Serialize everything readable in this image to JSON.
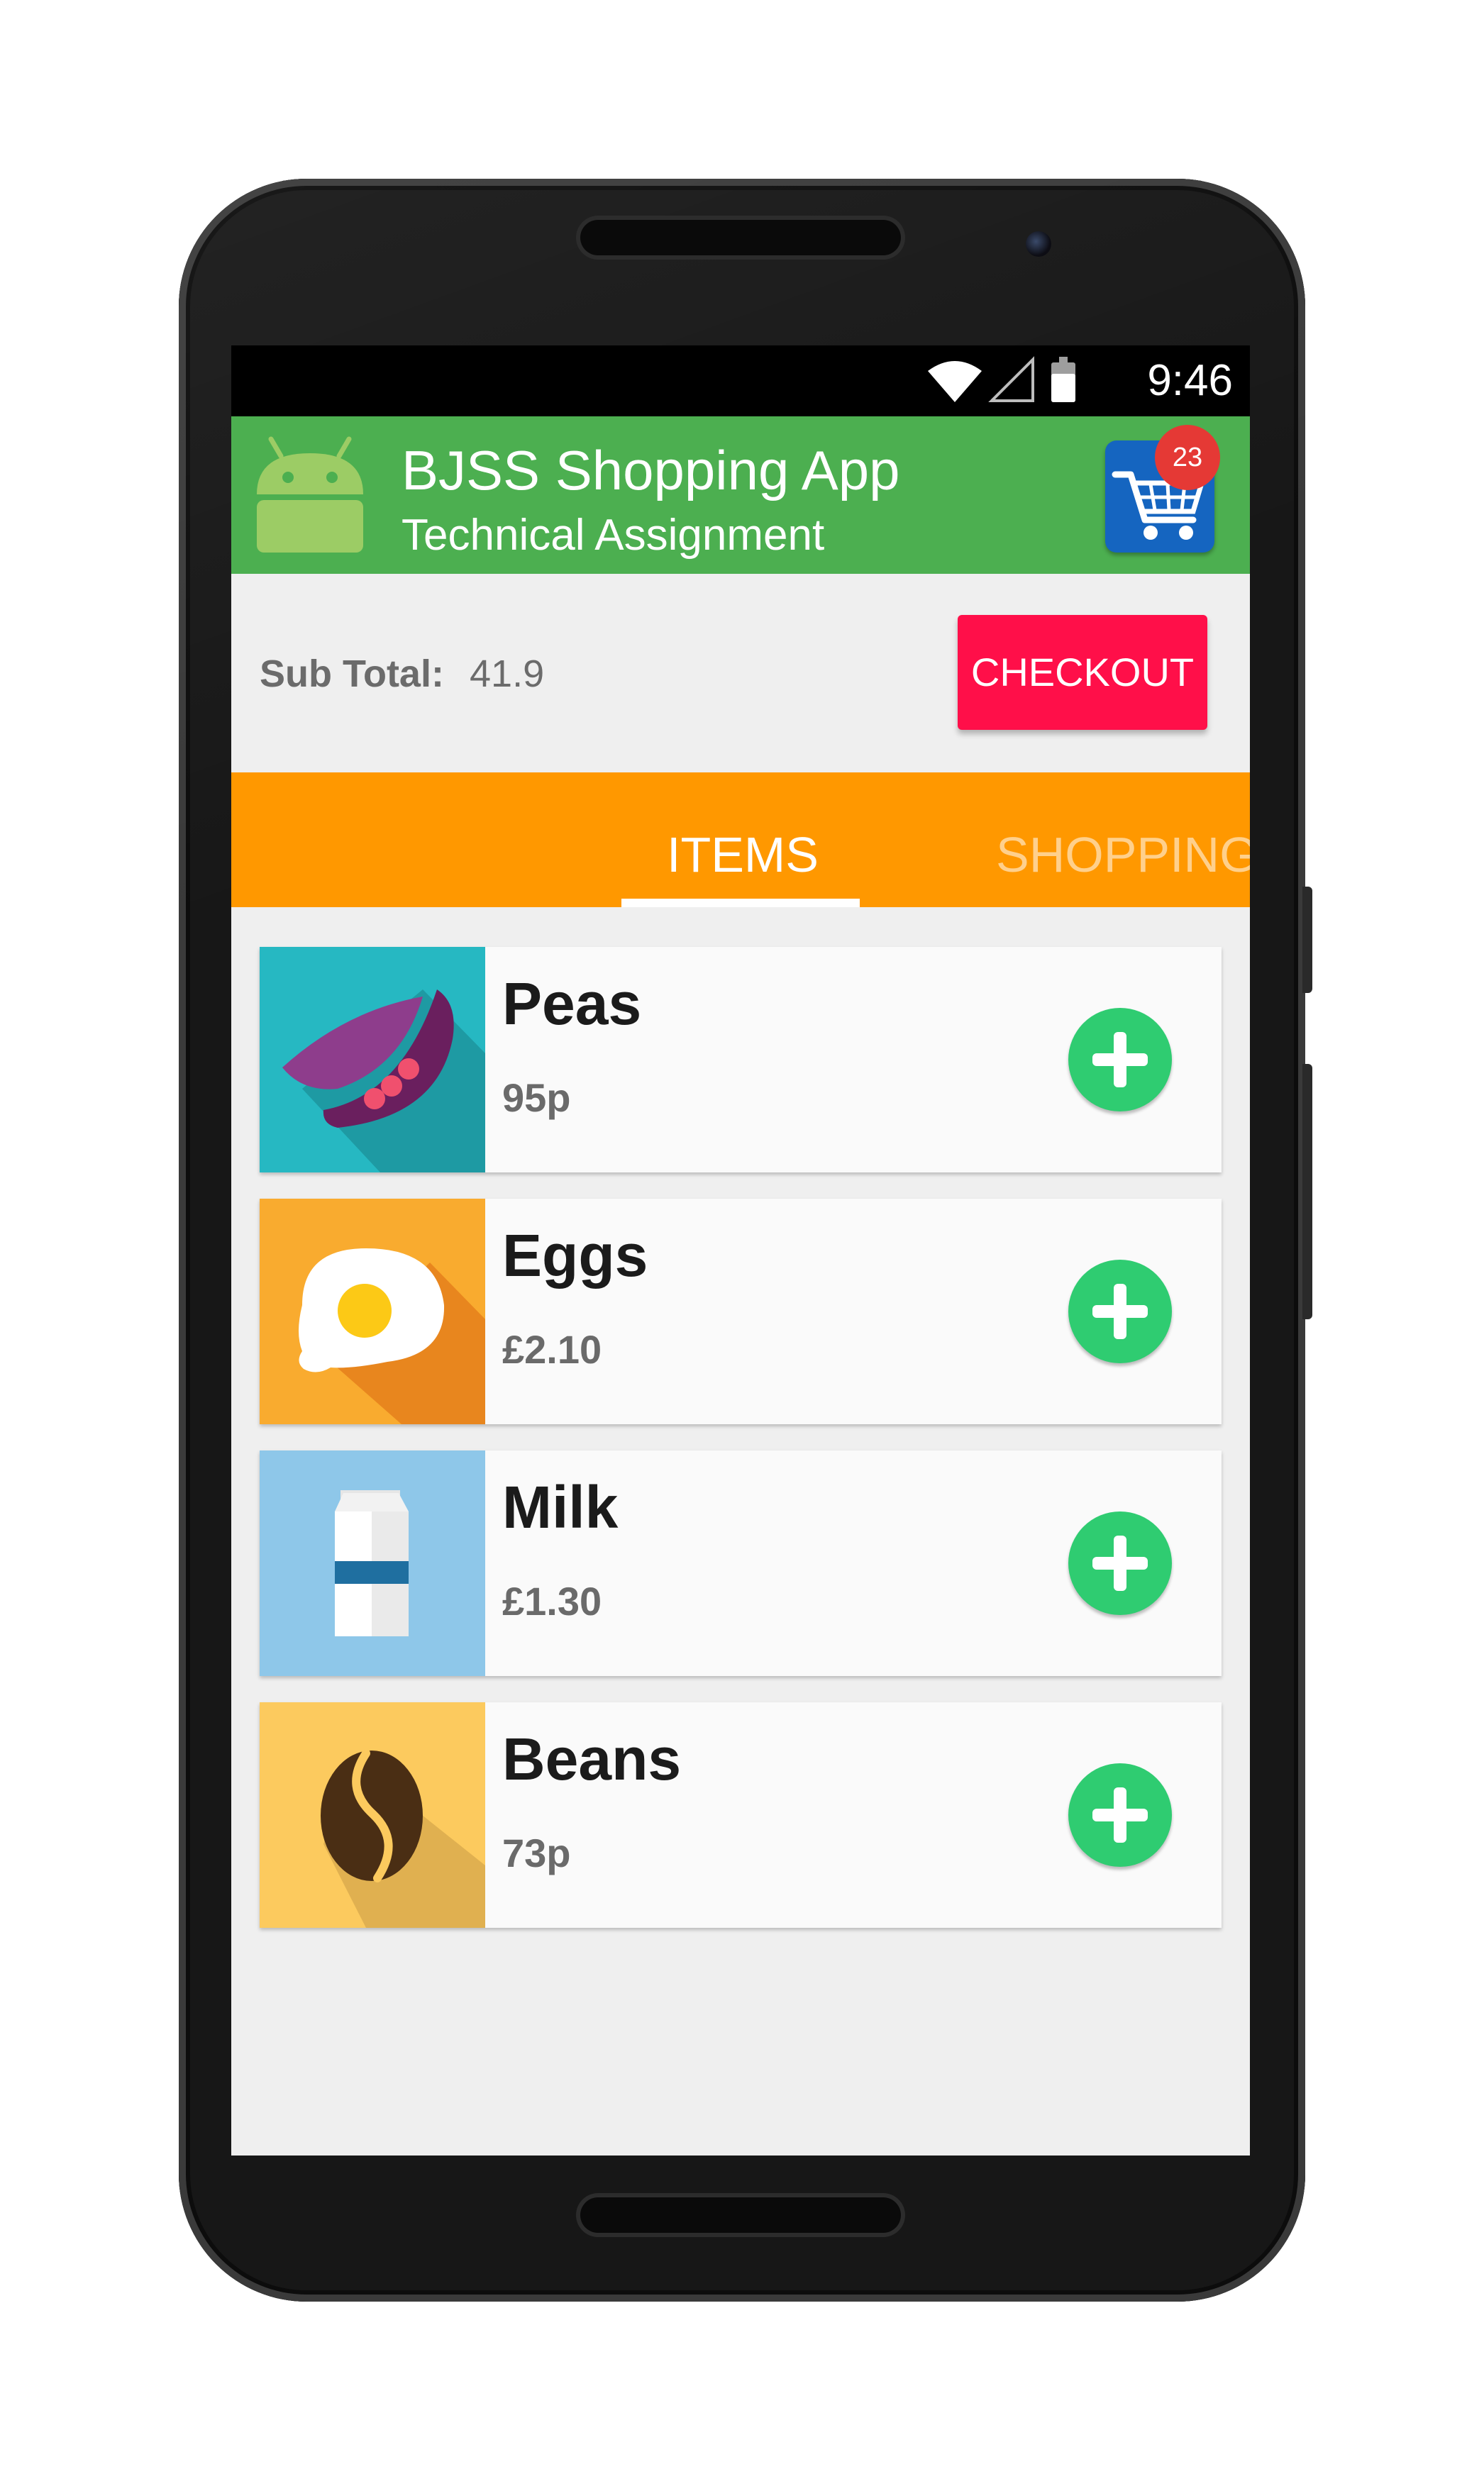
{
  "status_bar": {
    "time": "9:46",
    "icons": [
      "wifi-icon",
      "signal-icon",
      "battery-icon"
    ]
  },
  "app_bar": {
    "title": "BJSS Shopping App",
    "subtitle": "Technical Assignment",
    "cart_badge_count": "23",
    "colors": {
      "background": "#4caf50",
      "cart": "#1565c0",
      "badge": "#e53935"
    }
  },
  "summary": {
    "subtotal_label": "Sub Total:",
    "subtotal_value": "41.9",
    "checkout_label": "CHECKOUT",
    "checkout_color": "#ff0f49"
  },
  "tabs": [
    {
      "label": "ITEMS",
      "selected": true
    },
    {
      "label": "SHOPPING",
      "selected": false
    }
  ],
  "tab_bar_color": "#ff9800",
  "items": [
    {
      "name": "Peas",
      "price": "95p",
      "icon": "peas-icon",
      "tile_color": "#26b8c2"
    },
    {
      "name": "Eggs",
      "price": "£2.10",
      "icon": "fried-egg-icon",
      "tile_color": "#f9ab2f"
    },
    {
      "name": "Milk",
      "price": "£1.30",
      "icon": "milk-carton-icon",
      "tile_color": "#8ec7e9"
    },
    {
      "name": "Beans",
      "price": "73p",
      "icon": "coffee-bean-icon",
      "tile_color": "#fcca5e"
    }
  ],
  "add_button_color": "#2fcc71"
}
